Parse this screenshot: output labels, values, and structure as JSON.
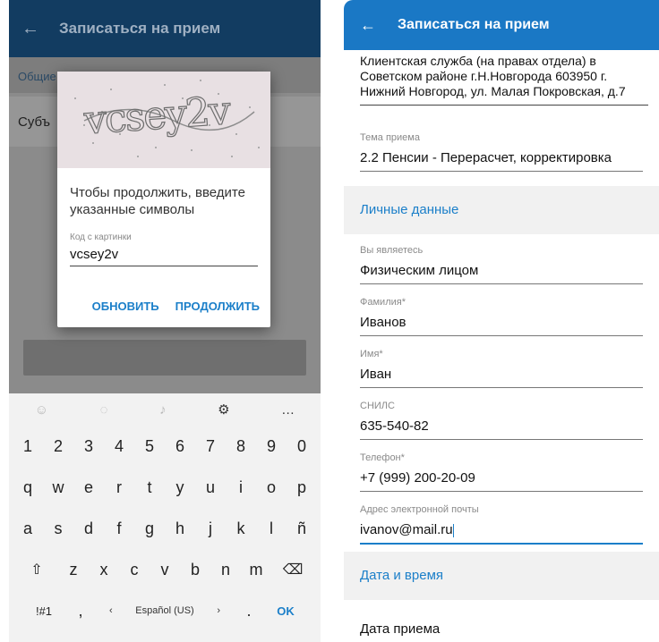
{
  "left": {
    "header": {
      "title": "Записаться на прием"
    },
    "bg": {
      "row1": "Общие данные",
      "row2": "Субъ"
    },
    "dialog": {
      "captcha_text": "vcsey2v",
      "title": "Чтобы продолжить, введите указанные символы",
      "label": "Код с картинки",
      "value": "vcsey2v",
      "refresh": "ОБНОВИТЬ",
      "continue": "ПРОДОЛЖИТЬ"
    },
    "keyboard": {
      "numbers": [
        "1",
        "2",
        "3",
        "4",
        "5",
        "6",
        "7",
        "8",
        "9",
        "0"
      ],
      "row1": [
        "q",
        "w",
        "e",
        "r",
        "t",
        "y",
        "u",
        "i",
        "o",
        "p"
      ],
      "row2": [
        "a",
        "s",
        "d",
        "f",
        "g",
        "h",
        "j",
        "k",
        "l",
        "ñ"
      ],
      "row3": [
        "z",
        "x",
        "c",
        "v",
        "b",
        "n",
        "m"
      ],
      "sym_label": "!#1",
      "comma": ",",
      "space_label": "Español (US)",
      "period": ".",
      "ok_label": "OK"
    }
  },
  "right": {
    "header": {
      "title": "Записаться на прием"
    },
    "address": "Клиентская служба (на правах отдела) в Советском районе г.Н.Новгорода 603950 г. Нижний Новгород, ул. Малая Покровская, д.7",
    "topic": {
      "label": "Тема приема",
      "value": "2.2 Пенсии - Перерасчет, корректировка"
    },
    "personal_section": "Личные данные",
    "fields": [
      {
        "label": "Вы являетесь",
        "value": "Физическим лицом"
      },
      {
        "label": "Фамилия*",
        "value": "Иванов"
      },
      {
        "label": "Имя*",
        "value": "Иван"
      },
      {
        "label": "СНИЛС",
        "value": "635-540-82"
      },
      {
        "label": "Телефон*",
        "value": "+7 (999) 200-20-09"
      },
      {
        "label": "Адрес электронной почты",
        "value": "ivanov@mail.ru"
      }
    ],
    "datetime_section": "Дата и время",
    "date_label": "Дата приема"
  }
}
